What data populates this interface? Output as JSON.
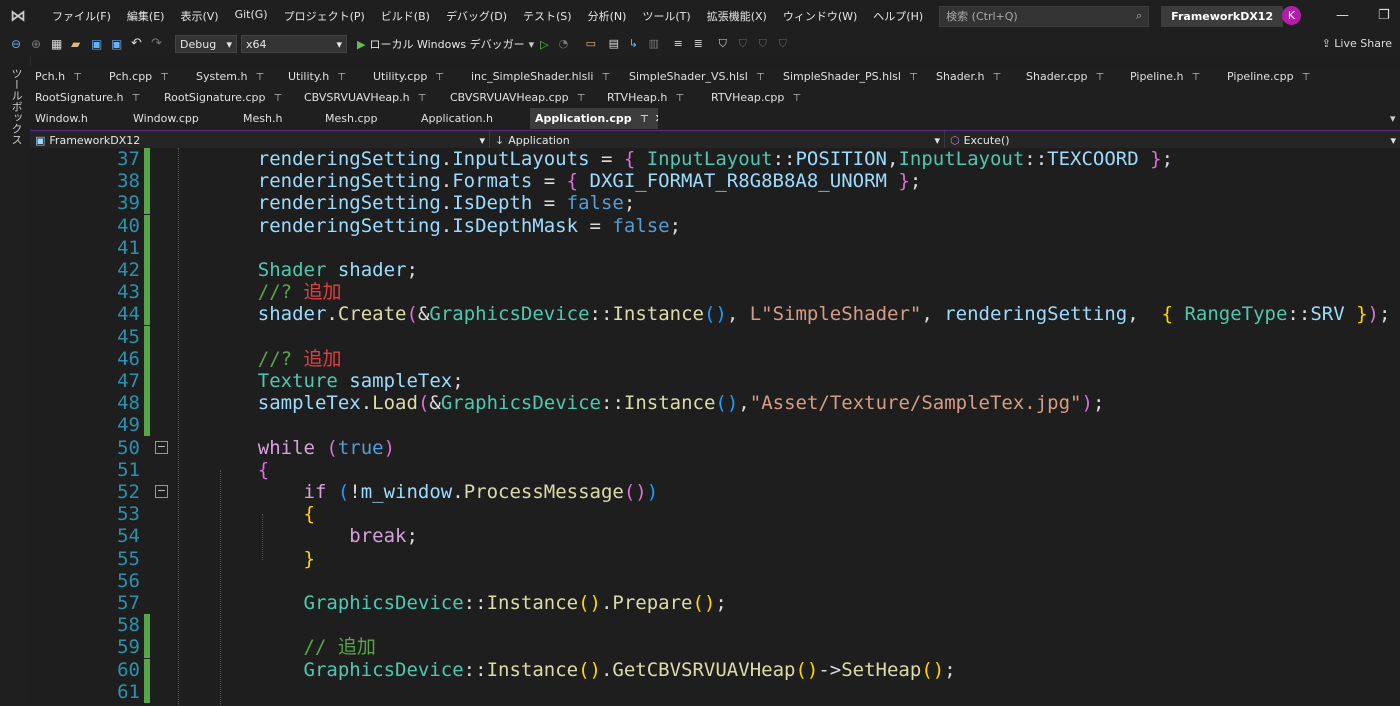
{
  "menubar": {
    "items": [
      "ファイル(F)",
      "編集(E)",
      "表示(V)",
      "Git(G)",
      "プロジェクト(P)",
      "ビルド(B)",
      "デバッグ(D)",
      "テスト(S)",
      "分析(N)",
      "ツール(T)",
      "拡張機能(X)",
      "ウィンドウ(W)",
      "ヘルプ(H)"
    ],
    "search_placeholder": "検索 (Ctrl+Q)",
    "project_name": "FrameworkDX12",
    "avatar_initial": "K"
  },
  "toolbar": {
    "config": "Debug",
    "platform": "x64",
    "run_label": "ローカル Windows デバッガー",
    "live_share": "Live Share"
  },
  "sidebar": {
    "label": "ツールボックス"
  },
  "tabs": {
    "row1": [
      {
        "label": "Pch.h",
        "pinned": true
      },
      {
        "label": "Pch.cpp",
        "pinned": true
      },
      {
        "label": "System.h",
        "pinned": true
      },
      {
        "label": "Utility.h",
        "pinned": true
      },
      {
        "label": "Utility.cpp",
        "pinned": true
      },
      {
        "label": "inc_SimpleShader.hlsli",
        "pinned": true
      },
      {
        "label": "SimpleShader_VS.hlsl",
        "pinned": true
      },
      {
        "label": "SimpleShader_PS.hlsl",
        "pinned": true
      },
      {
        "label": "Shader.h",
        "pinned": true
      },
      {
        "label": "Shader.cpp",
        "pinned": true
      },
      {
        "label": "Pipeline.h",
        "pinned": true
      },
      {
        "label": "Pipeline.cpp",
        "pinned": true
      }
    ],
    "row2": [
      {
        "label": "RootSignature.h",
        "pinned": true
      },
      {
        "label": "RootSignature.cpp",
        "pinned": true
      },
      {
        "label": "CBVSRVUAVHeap.h",
        "pinned": true
      },
      {
        "label": "CBVSRVUAVHeap.cpp",
        "pinned": true
      },
      {
        "label": "RTVHeap.h",
        "pinned": true
      },
      {
        "label": "RTVHeap.cpp",
        "pinned": true
      }
    ],
    "row3": [
      {
        "label": "Window.h",
        "pinned": false
      },
      {
        "label": "Window.cpp",
        "pinned": false
      },
      {
        "label": "Mesh.h",
        "pinned": false
      },
      {
        "label": "Mesh.cpp",
        "pinned": false
      },
      {
        "label": "Application.h",
        "pinned": false
      },
      {
        "label": "Application.cpp",
        "pinned": true,
        "active": true
      }
    ]
  },
  "navbar": {
    "project": "FrameworkDX12",
    "scope": "Application",
    "member": "Excute()"
  },
  "colors": {
    "plain": "#dcdcdc",
    "type": "#4ec9b0",
    "var": "#9cdcfe",
    "func": "#dcdcaa",
    "keyword": "#569cd6",
    "control": "#d8a0df",
    "string": "#d69d85",
    "comment": "#57a64a",
    "comment_jp": "#e04040",
    "macro": "#bd63c5",
    "bracket_gold": "#ffd700",
    "bracket_purple": "#da70d6",
    "bracket_blue": "#179fff"
  },
  "editor": {
    "lines": [
      {
        "n": 37,
        "chg": true,
        "segs": [
          [
            "    renderingSetting",
            "var"
          ],
          [
            ".",
            "plain"
          ],
          [
            "InputLayouts",
            "var"
          ],
          [
            " = ",
            "plain"
          ],
          [
            "{ ",
            "bracket_purple"
          ],
          [
            "InputLayout",
            "type"
          ],
          [
            "::",
            "plain"
          ],
          [
            "POSITION",
            "var"
          ],
          [
            ",",
            "plain"
          ],
          [
            "InputLayout",
            "type"
          ],
          [
            "::",
            "plain"
          ],
          [
            "TEXCOORD",
            "var"
          ],
          [
            " }",
            "bracket_purple"
          ],
          [
            ";",
            "plain"
          ]
        ]
      },
      {
        "n": 38,
        "chg": true,
        "segs": [
          [
            "    renderingSetting",
            "var"
          ],
          [
            ".",
            "plain"
          ],
          [
            "Formats",
            "var"
          ],
          [
            " = ",
            "plain"
          ],
          [
            "{ ",
            "bracket_purple"
          ],
          [
            "DXGI_FORMAT_R8G8B8A8_UNORM",
            "var"
          ],
          [
            " }",
            "bracket_purple"
          ],
          [
            ";",
            "plain"
          ]
        ]
      },
      {
        "n": 39,
        "chg": true,
        "segs": [
          [
            "    renderingSetting",
            "var"
          ],
          [
            ".",
            "plain"
          ],
          [
            "IsDepth",
            "var"
          ],
          [
            " = ",
            "plain"
          ],
          [
            "false",
            "keyword"
          ],
          [
            ";",
            "plain"
          ]
        ]
      },
      {
        "n": 40,
        "chg": true,
        "segs": [
          [
            "    renderingSetting",
            "var"
          ],
          [
            ".",
            "plain"
          ],
          [
            "IsDepthMask",
            "var"
          ],
          [
            " = ",
            "plain"
          ],
          [
            "false",
            "keyword"
          ],
          [
            ";",
            "plain"
          ]
        ]
      },
      {
        "n": 41,
        "chg": true,
        "segs": []
      },
      {
        "n": 42,
        "chg": true,
        "segs": [
          [
            "    Shader",
            "type"
          ],
          [
            " shader",
            "var"
          ],
          [
            ";",
            "plain"
          ]
        ]
      },
      {
        "n": 43,
        "chg": true,
        "segs": [
          [
            "    //? ",
            "comment"
          ],
          [
            "追加",
            "comment_jp"
          ]
        ]
      },
      {
        "n": 44,
        "chg": true,
        "segs": [
          [
            "    shader",
            "var"
          ],
          [
            ".",
            "plain"
          ],
          [
            "Create",
            "func"
          ],
          [
            "(",
            "bracket_purple"
          ],
          [
            "&",
            "plain"
          ],
          [
            "GraphicsDevice",
            "type"
          ],
          [
            "::",
            "plain"
          ],
          [
            "Instance",
            "func"
          ],
          [
            "()",
            "bracket_blue"
          ],
          [
            ", ",
            "plain"
          ],
          [
            "L\"SimpleShader\"",
            "string"
          ],
          [
            ", ",
            "plain"
          ],
          [
            "renderingSetting",
            "var"
          ],
          [
            ", ",
            "plain"
          ],
          [
            " {",
            "bracket_gold"
          ],
          [
            " RangeType",
            "type"
          ],
          [
            "::",
            "plain"
          ],
          [
            "SRV",
            "var"
          ],
          [
            " }",
            "bracket_gold"
          ],
          [
            ")",
            "bracket_purple"
          ],
          [
            ";",
            "plain"
          ]
        ]
      },
      {
        "n": 45,
        "chg": true,
        "segs": []
      },
      {
        "n": 46,
        "chg": true,
        "segs": [
          [
            "    //? ",
            "comment"
          ],
          [
            "追加",
            "comment_jp"
          ]
        ]
      },
      {
        "n": 47,
        "chg": true,
        "segs": [
          [
            "    Texture",
            "type"
          ],
          [
            " sampleTex",
            "var"
          ],
          [
            ";",
            "plain"
          ]
        ]
      },
      {
        "n": 48,
        "chg": true,
        "segs": [
          [
            "    sampleTex",
            "var"
          ],
          [
            ".",
            "plain"
          ],
          [
            "Load",
            "func"
          ],
          [
            "(",
            "bracket_purple"
          ],
          [
            "&",
            "plain"
          ],
          [
            "GraphicsDevice",
            "type"
          ],
          [
            "::",
            "plain"
          ],
          [
            "Instance",
            "func"
          ],
          [
            "()",
            "bracket_blue"
          ],
          [
            ",",
            "plain"
          ],
          [
            "\"Asset/Texture/SampleTex.jpg\"",
            "string"
          ],
          [
            ")",
            "bracket_purple"
          ],
          [
            ";",
            "plain"
          ]
        ]
      },
      {
        "n": 49,
        "chg": true,
        "segs": []
      },
      {
        "n": 50,
        "chg": false,
        "fold": true,
        "segs": [
          [
            "    while",
            "control"
          ],
          [
            " (",
            "bracket_purple"
          ],
          [
            "true",
            "keyword"
          ],
          [
            ")",
            "bracket_purple"
          ]
        ]
      },
      {
        "n": 51,
        "chg": false,
        "segs": [
          [
            "    {",
            "bracket_purple"
          ]
        ]
      },
      {
        "n": 52,
        "chg": false,
        "fold": true,
        "segs": [
          [
            "        if",
            "control"
          ],
          [
            " (",
            "bracket_blue"
          ],
          [
            "!",
            "plain"
          ],
          [
            "m_window",
            "var"
          ],
          [
            ".",
            "plain"
          ],
          [
            "ProcessMessage",
            "func"
          ],
          [
            "()",
            "bracket_purple"
          ],
          [
            ")",
            "bracket_blue"
          ]
        ]
      },
      {
        "n": 53,
        "chg": false,
        "segs": [
          [
            "        {",
            "bracket_gold"
          ]
        ]
      },
      {
        "n": 54,
        "chg": false,
        "segs": [
          [
            "            break",
            "control"
          ],
          [
            ";",
            "plain"
          ]
        ]
      },
      {
        "n": 55,
        "chg": false,
        "segs": [
          [
            "        }",
            "bracket_gold"
          ]
        ]
      },
      {
        "n": 56,
        "chg": false,
        "segs": []
      },
      {
        "n": 57,
        "chg": false,
        "segs": [
          [
            "        GraphicsDevice",
            "type"
          ],
          [
            "::",
            "plain"
          ],
          [
            "Instance",
            "func"
          ],
          [
            "()",
            "bracket_gold"
          ],
          [
            ".",
            "plain"
          ],
          [
            "Prepare",
            "func"
          ],
          [
            "()",
            "bracket_gold"
          ],
          [
            ";",
            "plain"
          ]
        ]
      },
      {
        "n": 58,
        "chg": true,
        "segs": []
      },
      {
        "n": 59,
        "chg": true,
        "segs": [
          [
            "        // 追加",
            "comment"
          ]
        ]
      },
      {
        "n": 60,
        "chg": true,
        "segs": [
          [
            "        GraphicsDevice",
            "type"
          ],
          [
            "::",
            "plain"
          ],
          [
            "Instance",
            "func"
          ],
          [
            "()",
            "bracket_gold"
          ],
          [
            ".",
            "plain"
          ],
          [
            "GetCBVSRVUAVHeap",
            "func"
          ],
          [
            "()",
            "bracket_gold"
          ],
          [
            "->",
            "plain"
          ],
          [
            "SetHeap",
            "func"
          ],
          [
            "()",
            "bracket_gold"
          ],
          [
            ";",
            "plain"
          ]
        ]
      },
      {
        "n": 61,
        "chg": true,
        "segs": []
      }
    ]
  }
}
